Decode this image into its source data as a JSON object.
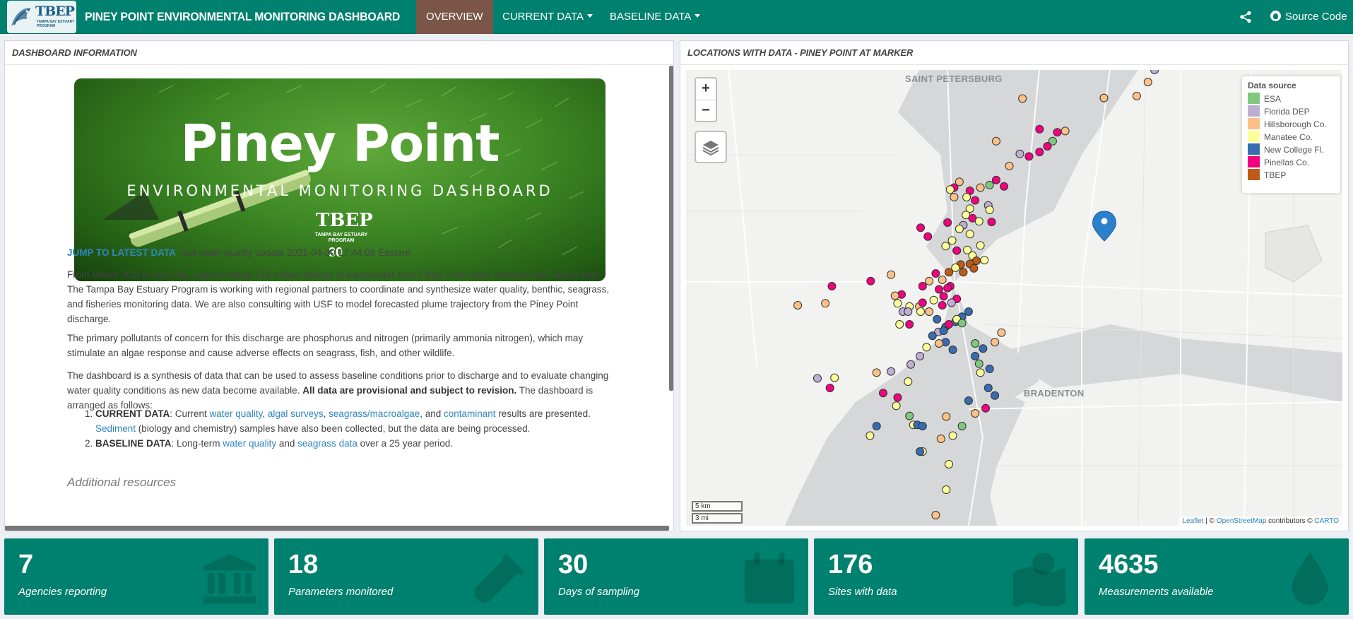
{
  "navbar": {
    "logo_text": "TBEP",
    "logo_sub": "TAMPA BAY ESTUARY PROGRAM",
    "title": "PINEY POINT ENVIRONMENTAL MONITORING DASHBOARD",
    "tabs": [
      {
        "label": "OVERVIEW",
        "active": true
      },
      {
        "label": "CURRENT DATA",
        "dropdown": true
      },
      {
        "label": "BASELINE DATA",
        "dropdown": true
      }
    ],
    "share_icon": "share-icon",
    "source_label": "Source Code",
    "source_icon": "github-icon",
    "color": "#00806e",
    "active_color": "#7a5548"
  },
  "left_panel": {
    "header": "DASHBOARD INFORMATION",
    "banner": {
      "title": "Piney Point",
      "subtitle": "ENVIRONMENTAL MONITORING DASHBOARD",
      "logo": "TBEP",
      "logo_sub": "TAMPA BAY ESTUARY PROGRAM",
      "logo_30": "30"
    },
    "jump_link": "JUMP TO LATEST DATA",
    "jump_suffix": ", last water quality update 2021-04-30 17:44:08 Eastern",
    "para1": "From March 30th to April 9th, approximately 215 million gallons of wastewater from Piney Point were released into Tampa Bay. The Tampa Bay Estuary Program is working with regional partners to coordinate and synthesize water quality, benthic, seagrass, and fisheries monitoring data. We are also consulting with USF to model forecasted plume trajectory from the Piney Point discharge.",
    "para2": "The primary pollutants of concern for this discharge are phosphorus and nitrogen (primarily ammonia nitrogen), which may stimulate an algae response and cause adverse effects on seagrass, fish, and other wildlife.",
    "para3_a": "The dashboard is a synthesis of data that can be used to assess baseline conditions prior to discharge and to evaluate changing water quality conditions as new data become available. ",
    "para3_b": "All data are provisional and subject to revision.",
    "para3_c": " The dashboard is arranged as follows:",
    "list": {
      "item1_head": "CURRENT DATA",
      "item1_a": ": Current ",
      "item1_l1": "water quality",
      "item1_s1": ", ",
      "item1_l2": "algal surveys",
      "item1_s2": ", ",
      "item1_l3": "seagrass/macroalgae",
      "item1_s3": ", and ",
      "item1_l4": "contaminant",
      "item1_b": " results are presented. ",
      "item1_l5": "Sediment",
      "item1_c": " (biology and chemistry) samples have also been collected, but the data are being processed.",
      "item2_head": "BASELINE DATA",
      "item2_a": ": Long-term ",
      "item2_l1": "water quality",
      "item2_b": " and ",
      "item2_l2": "seagrass data",
      "item2_c": " over a 25 year period."
    },
    "additional": "Additional resources"
  },
  "right_panel": {
    "header": "LOCATIONS WITH DATA - PINEY POINT AT MARKER",
    "map": {
      "zoom_in": "+",
      "zoom_out": "−",
      "layers_icon": "layers-icon",
      "city_labels": [
        "SAINT PETERSBURG",
        "BRADENTON"
      ],
      "legend_title": "Data source",
      "legend": [
        {
          "label": "ESA",
          "color": "#7fc97f"
        },
        {
          "label": "Florida DEP",
          "color": "#beaed4"
        },
        {
          "label": "Hillsborough Co.",
          "color": "#fdc086"
        },
        {
          "label": "Manatee Co.",
          "color": "#ffff99"
        },
        {
          "label": "New College Fl.",
          "color": "#386cb0"
        },
        {
          "label": "Pinellas Co.",
          "color": "#f0027f"
        },
        {
          "label": "TBEP",
          "color": "#bf5b17"
        }
      ],
      "scale_km": "5 km",
      "scale_mi": "3 mi",
      "attribution": {
        "leaflet": "Leaflet",
        "sep1": " | © ",
        "osm": "OpenStreetMap",
        "mid": " contributors © ",
        "carto": "CARTO"
      },
      "marker_icon": "map-pin-icon"
    }
  },
  "stats": [
    {
      "value": "7",
      "label": "Agencies reporting",
      "icon": "bank-icon"
    },
    {
      "value": "18",
      "label": "Parameters monitored",
      "icon": "test-tube-icon"
    },
    {
      "value": "30",
      "label": "Days of sampling",
      "icon": "calendar-icon"
    },
    {
      "value": "176",
      "label": "Sites with data",
      "icon": "map-icon"
    },
    {
      "value": "4635",
      "label": "Measurements available",
      "icon": "droplet-icon"
    }
  ]
}
